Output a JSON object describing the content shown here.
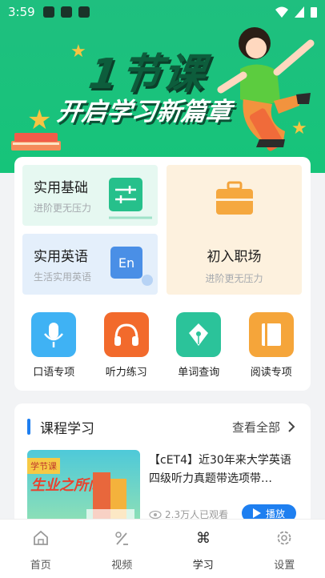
{
  "status_bar": {
    "time": "3:59"
  },
  "hero": {
    "line1": "1节课",
    "line2": "开启学习新篇章"
  },
  "tiles": {
    "basic": {
      "title": "实用基础",
      "subtitle": "进阶更无压力"
    },
    "english": {
      "title": "实用英语",
      "subtitle": "生活实用英语",
      "icon_text": "En"
    },
    "job": {
      "title": "初入职场",
      "subtitle": "进阶更无压力"
    }
  },
  "skills": [
    {
      "label": "口语专项",
      "icon": "microphone-icon",
      "color": "#42b3f5"
    },
    {
      "label": "听力练习",
      "icon": "headphones-icon",
      "color": "#f26a2c"
    },
    {
      "label": "单词查询",
      "icon": "pen-nib-icon",
      "color": "#2bc39a"
    },
    {
      "label": "阅读专项",
      "icon": "book-icon",
      "color": "#f5a53a"
    }
  ],
  "courses": {
    "section_title": "课程学习",
    "more_label": "查看全部",
    "item": {
      "title": "【cET4】近30年来大学英语四级听力真题带选项带…",
      "views": "2.3万人已观看",
      "play_label": "播放",
      "thumb_text": "学节课 生业之所向"
    }
  },
  "tabbar": [
    {
      "label": "首页",
      "icon": "home-icon"
    },
    {
      "label": "视频",
      "icon": "video-icon"
    },
    {
      "label": "学习",
      "icon": "study-icon",
      "active": true
    },
    {
      "label": "设置",
      "icon": "settings-icon"
    }
  ],
  "colors": {
    "accent_blue": "#1e7ff0",
    "hero_green": "#1fbf7f"
  }
}
